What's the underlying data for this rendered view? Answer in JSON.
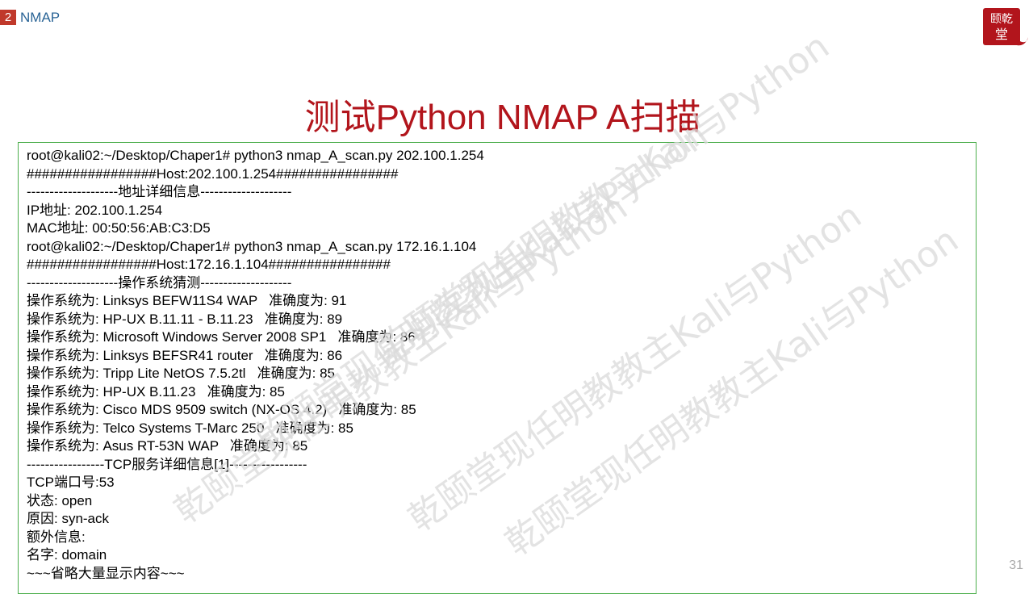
{
  "section": {
    "number": "2",
    "title": "NMAP"
  },
  "logo": {
    "text": "乾颐堂"
  },
  "slide_title": "测试Python NMAP A扫描",
  "terminal": {
    "lines": [
      "root@kali02:~/Desktop/Chaper1# python3 nmap_A_scan.py 202.100.1.254",
      "#################Host:202.100.1.254################",
      "--------------------地址详细信息--------------------",
      "IP地址: 202.100.1.254",
      "MAC地址: 00:50:56:AB:C3:D5",
      "root@kali02:~/Desktop/Chaper1# python3 nmap_A_scan.py 172.16.1.104",
      "#################Host:172.16.1.104################",
      "--------------------操作系统猜测--------------------",
      "操作系统为: Linksys BEFW11S4 WAP   准确度为: 91",
      "操作系统为: HP-UX B.11.11 - B.11.23   准确度为: 89",
      "操作系统为: Microsoft Windows Server 2008 SP1   准确度为: 86",
      "操作系统为: Linksys BEFSR41 router   准确度为: 86",
      "操作系统为: Tripp Lite NetOS 7.5.2tl   准确度为: 85",
      "操作系统为: HP-UX B.11.23   准确度为: 85",
      "操作系统为: Cisco MDS 9509 switch (NX-OS 4.2)   准确度为: 85",
      "操作系统为: Telco Systems T-Marc 250   准确度为: 85",
      "操作系统为: Asus RT-53N WAP   准确度为: 85",
      "-----------------TCP服务详细信息[1]-----------------",
      "TCP端口号:53",
      "状态: open",
      "原因: syn-ack",
      "额外信息:",
      "名字: domain",
      "~~~省略大量显示内容~~~"
    ]
  },
  "watermark": {
    "text": "乾颐堂现任明教教主Kali与Python",
    "color": "#d9d9d9"
  },
  "page_number": "31",
  "colors": {
    "title": "#b2151c",
    "section": "#2a6496",
    "badge": "#c0392b",
    "border": "#4cae4c"
  }
}
